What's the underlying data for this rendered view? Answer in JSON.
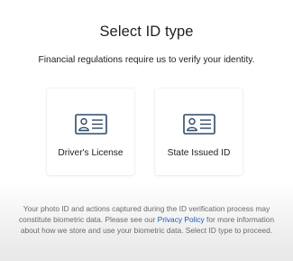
{
  "header": {
    "title": "Select ID type",
    "subtitle": "Financial regulations require us to verify your identity."
  },
  "options": [
    {
      "label": "Driver's License",
      "icon": "id-card-icon"
    },
    {
      "label": "State Issued ID",
      "icon": "id-card-icon"
    }
  ],
  "notice": {
    "text_before": "Your photo ID and actions captured during the ID verification process may constitute biometric data. Please see our ",
    "link_text": "Privacy Policy",
    "text_after": " for more information about how we store and use your biometric data. Select ID type to proceed."
  },
  "colors": {
    "icon": "#2e4a66",
    "link": "#1f5bb5"
  }
}
